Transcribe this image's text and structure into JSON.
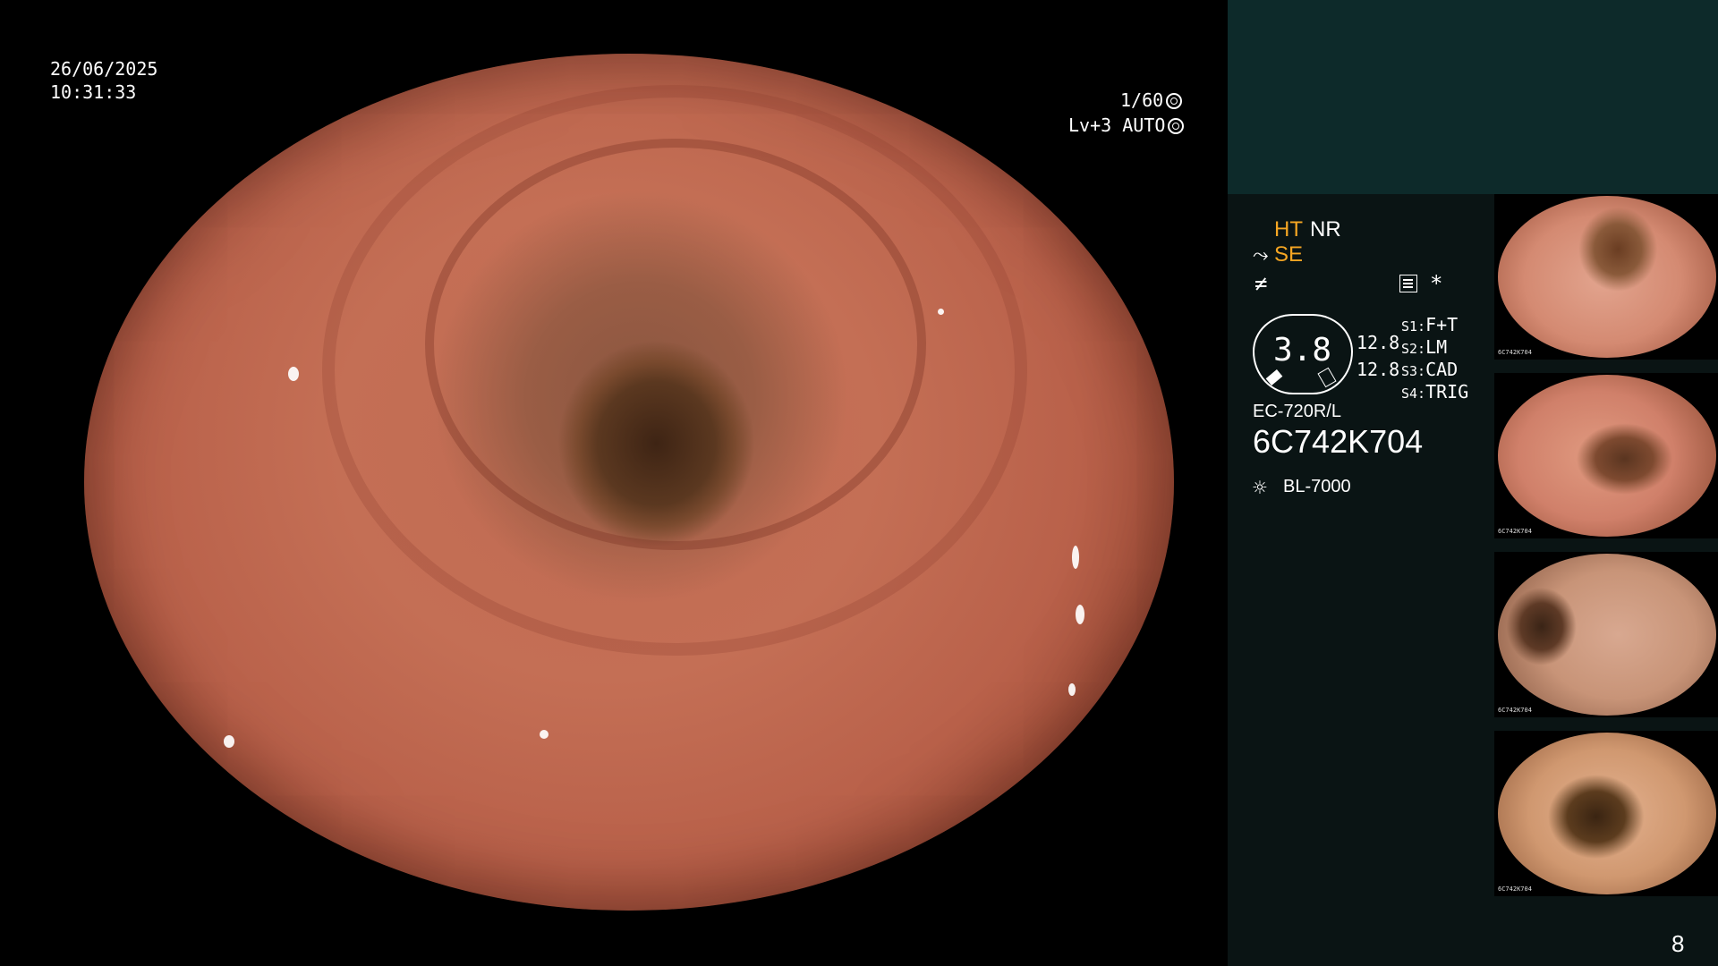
{
  "capture": {
    "date": "26/06/2025",
    "time": "10:31:33",
    "shutter": "1/60",
    "level": "Lv+3 AUTO"
  },
  "panel": {
    "mode_ht": "HT",
    "mode_nr": "NR",
    "mode_se": "SE",
    "sharpness_symbol": "≠",
    "star_symbol": "*",
    "gauge_value": "3.8",
    "value_top": "12.8",
    "value_bottom": "12.8",
    "switches": [
      {
        "label": "S1:",
        "value": "F+T"
      },
      {
        "label": "S2:",
        "value": "LM"
      },
      {
        "label": "S3:",
        "value": "CAD"
      },
      {
        "label": "S4:",
        "value": "TRIG"
      }
    ],
    "scope_model": "EC-720R/L",
    "scope_serial": "6C742K704",
    "light_source": "BL-7000"
  },
  "thumbnails": [
    {
      "footer": "6C742K704"
    },
    {
      "footer": "6C742K704"
    },
    {
      "footer": "6C742K704"
    },
    {
      "footer": "6C742K704"
    }
  ],
  "page_number": "8",
  "colors": {
    "accent_orange": "#f5a623",
    "sidebar_bg": "#0a1414",
    "sidebar_top_bg": "#0d2a2a"
  }
}
